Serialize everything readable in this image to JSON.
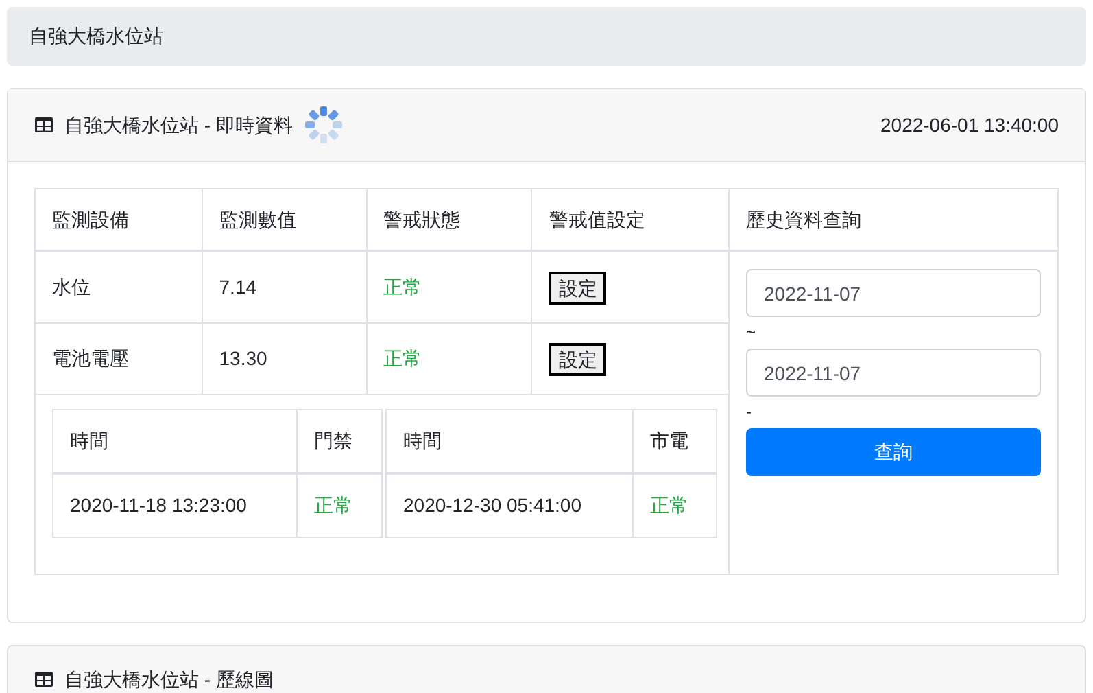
{
  "breadcrumb": "自強大橋水位站",
  "realtime_card": {
    "title": "自強大橋水位站 - 即時資料",
    "loading": true,
    "timestamp": "2022-06-01 13:40:00"
  },
  "sensor_table": {
    "columns": [
      "監測設備",
      "監測數值",
      "警戒狀態",
      "警戒值設定"
    ],
    "rows": [
      {
        "device": "水位",
        "value": "7.14",
        "status": "正常",
        "button": "設定"
      },
      {
        "device": "電池電壓",
        "value": "13.30",
        "status": "正常",
        "button": "設定"
      }
    ]
  },
  "event_tables": [
    {
      "columns": [
        "時間",
        "門禁"
      ],
      "rows": [
        {
          "time": "2020-11-18 13:23:00",
          "status": "正常"
        }
      ]
    },
    {
      "columns": [
        "時間",
        "市電"
      ],
      "rows": [
        {
          "time": "2020-12-30 05:41:00",
          "status": "正常"
        }
      ]
    }
  ],
  "history_query": {
    "heading": "歷史資料查詢",
    "start": "2022-11-07",
    "separator": "~",
    "end": "2022-11-07",
    "separator_2": "-",
    "button": "查詢"
  },
  "chart_card": {
    "title": "自強大橋水位站 - 歷線圖"
  }
}
